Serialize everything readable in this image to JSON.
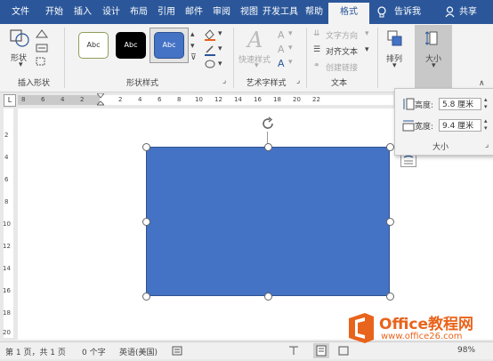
{
  "tabs": [
    "文件",
    "开始",
    "插入",
    "设计",
    "布局",
    "引用",
    "邮件",
    "审阅",
    "视图",
    "开发工具",
    "帮助",
    "格式"
  ],
  "tell_me": "告诉我",
  "share": "共享",
  "ribbon": {
    "insert_shapes": {
      "shape_label": "形状",
      "group_label": "插入形状"
    },
    "shape_styles": {
      "style_text": "Abc",
      "group_label": "形状样式"
    },
    "wordart": {
      "quick_styles": "快速样式",
      "group_label": "艺术字样式"
    },
    "text": {
      "text_direction": "文字方向",
      "align_text": "对齐文本",
      "create_link": "创建链接",
      "group_label": "文本"
    },
    "arrange": {
      "label": "排列"
    },
    "size": {
      "label": "大小"
    }
  },
  "size_panel": {
    "height_label": "高度:",
    "height_value": "5.8 厘米",
    "width_label": "宽度:",
    "width_value": "9.4 厘米",
    "group_label": "大小"
  },
  "ruler": {
    "h_ticks": [
      "8",
      "6",
      "4",
      "2",
      "2",
      "4",
      "6",
      "8",
      "10",
      "12",
      "14",
      "16",
      "18",
      "20",
      "22"
    ],
    "v_ticks": [
      "2",
      "4",
      "6",
      "8",
      "10",
      "12",
      "14",
      "16",
      "18",
      "20"
    ]
  },
  "status": {
    "page": "第 1 页，共 1 页",
    "words": "0 个字",
    "language": "英语(美国)",
    "zoom": "98%"
  },
  "watermark": {
    "brand": "Office教程网",
    "url": "www.office26.com"
  },
  "colors": {
    "tab_bar": "#2b579a",
    "shape_fill": "#4472c4",
    "brand_orange": "#e8641c"
  }
}
